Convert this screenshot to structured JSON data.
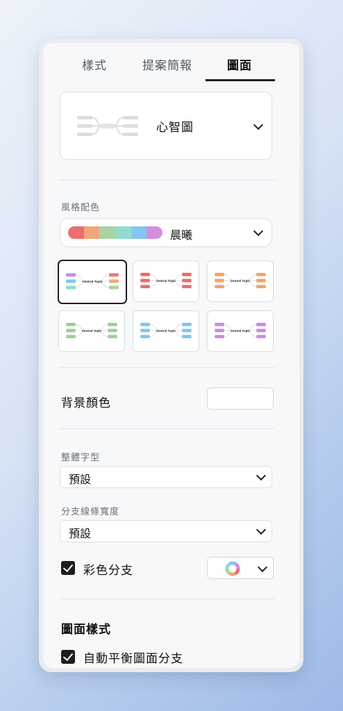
{
  "tabs": [
    {
      "label": "樣式"
    },
    {
      "label": "提案簡報"
    },
    {
      "label": "圖面"
    }
  ],
  "active_tab": "圖面",
  "structure": {
    "label": "心智圖",
    "icon": "mindmap-structure-icon"
  },
  "color_theme": {
    "section_label": "風格配色",
    "selected_label": "晨曦",
    "palette": [
      "#ee6e6e",
      "#f2a578",
      "#a9d3a5",
      "#90dcd0",
      "#83c6ef",
      "#d48ee0"
    ],
    "thumbnails": [
      {
        "center": "Central Topic",
        "colors": [
          "#c58de0",
          "#7ec8ef",
          "#8fdccc"
        ],
        "right_colors": [
          "#e27f7f",
          "#f0a978",
          "#a7d3a0"
        ],
        "selected": true
      },
      {
        "center": "Central Topic",
        "colors": [
          "#e76d6d",
          "#e76d6d",
          "#e76d6d"
        ],
        "right_colors": [
          "#e76d6d",
          "#e76d6d",
          "#e76d6d"
        ],
        "selected": false
      },
      {
        "center": "Central Topic",
        "colors": [
          "#f2a46b",
          "#f2a46b",
          "#f2a46b"
        ],
        "right_colors": [
          "#f2a46b",
          "#f2a46b",
          "#f2a46b"
        ],
        "selected": false
      },
      {
        "center": "Central Topic",
        "colors": [
          "#9ccf96",
          "#9ccf96",
          "#9ccf96"
        ],
        "right_colors": [
          "#9ccf96",
          "#9ccf96",
          "#9ccf96"
        ],
        "selected": false
      },
      {
        "center": "Central Topic",
        "colors": [
          "#7ec5ee",
          "#7ec5ee",
          "#7ec5ee"
        ],
        "right_colors": [
          "#7ec5ee",
          "#7ec5ee",
          "#7ec5ee"
        ],
        "selected": false
      },
      {
        "center": "Central Topic",
        "colors": [
          "#c98be3",
          "#c98be3",
          "#c98be3"
        ],
        "right_colors": [
          "#c98be3",
          "#c98be3",
          "#c98be3"
        ],
        "selected": false
      }
    ]
  },
  "background_color": {
    "label": "背景顏色",
    "value": "#ffffff"
  },
  "font": {
    "label": "整體字型",
    "value": "預設"
  },
  "line_width": {
    "label": "分支線條寬度",
    "value": "預設"
  },
  "colorful_branch": {
    "label": "彩色分支",
    "checked": true
  },
  "map_style": {
    "heading": "圖面樣式",
    "auto_balance_label": "自動平衡圖面分支",
    "auto_balance_checked": true
  }
}
